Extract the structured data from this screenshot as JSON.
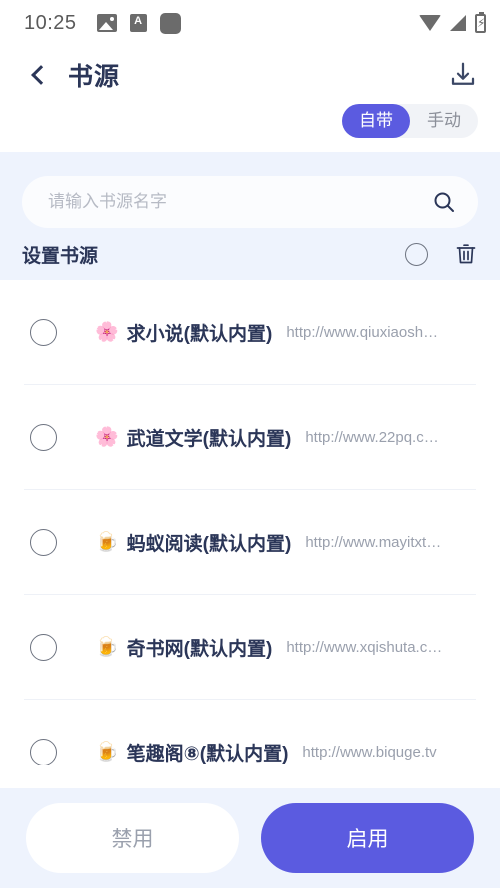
{
  "status_bar": {
    "time": "10:25",
    "left_icons": [
      "photo-icon",
      "ascii-icon",
      "rounded-square-icon"
    ],
    "right_icons": [
      "wifi-icon",
      "signal-icon",
      "battery-icon"
    ],
    "battery_glyph": "⚡"
  },
  "header": {
    "back_label": "",
    "title": "书源",
    "download_label": ""
  },
  "segment": {
    "options": [
      {
        "label": "自带",
        "active": true
      },
      {
        "label": "手动",
        "active": false
      }
    ]
  },
  "search": {
    "placeholder": "请输入书源名字",
    "value": ""
  },
  "list_header": {
    "title": "设置书源",
    "select_all_checked": false
  },
  "list": {
    "rows": [
      {
        "checked": false,
        "emoji": "🌸",
        "name": "求小说(默认内置)",
        "url": "http://www.qiuxiaosh…"
      },
      {
        "checked": false,
        "emoji": "🌸",
        "name": "武道文学(默认内置)",
        "url": "http://www.22pq.c…"
      },
      {
        "checked": false,
        "emoji": "🍺",
        "name": "蚂蚁阅读(默认内置)",
        "url": "http://www.mayitxt…"
      },
      {
        "checked": false,
        "emoji": "🍺",
        "name": "奇书网(默认内置)",
        "url": "http://www.xqishuta.c…"
      },
      {
        "checked": false,
        "emoji": "🍺",
        "name": "笔趣阁⑧(默认内置)",
        "url": "http://www.biquge.tv"
      }
    ]
  },
  "bottom_bar": {
    "disable_label": "禁用",
    "enable_label": "启用"
  },
  "colors": {
    "accent": "#5b5be0",
    "title": "#2b3658",
    "panel_bg": "#eef3fd",
    "muted": "#9aa0ad"
  }
}
